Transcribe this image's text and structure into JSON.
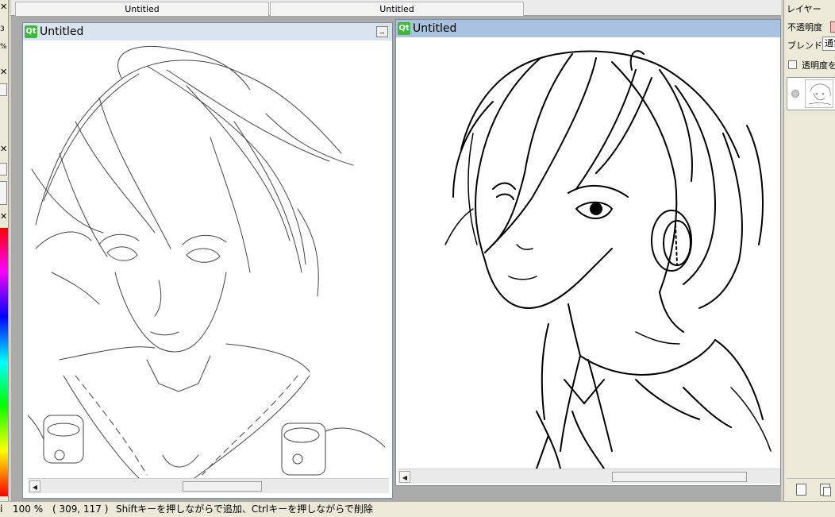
{
  "left_panel": {
    "close_glyph": "✕",
    "fragment_a": "3",
    "fragment_b": "%"
  },
  "mdi": {
    "tabs": [
      "Untitled",
      "Untitled"
    ]
  },
  "window_left": {
    "title": "Untitled",
    "logo": "Qt",
    "minimize_glyph": "_"
  },
  "window_right": {
    "title": "Untitled",
    "logo": "Qt"
  },
  "layer_panel": {
    "title": "レイヤー",
    "opacity_label": "不透明度",
    "blend_label": "ブレンド",
    "blend_value": "通常",
    "preserve_alpha_label": "透明度を保護"
  },
  "statusbar": {
    "left_fragment": "i",
    "zoom": "100 %",
    "coords": "( 309, 117 )",
    "hint": "Shiftキーを押しながらで追加、Ctrlキーを押しながらで削除"
  },
  "colors": {
    "title_left": "#d9e4ef",
    "title_right": "#a9c2e0",
    "mdi_bg": "#aaaaaa",
    "panel_bg": "#ece9d8"
  },
  "icons": [
    "close-icon",
    "qt-logo-icon",
    "minimize-icon",
    "scroll-left-arrow-icon",
    "visibility-icon",
    "new-layer-icon",
    "duplicate-layer-icon"
  ]
}
